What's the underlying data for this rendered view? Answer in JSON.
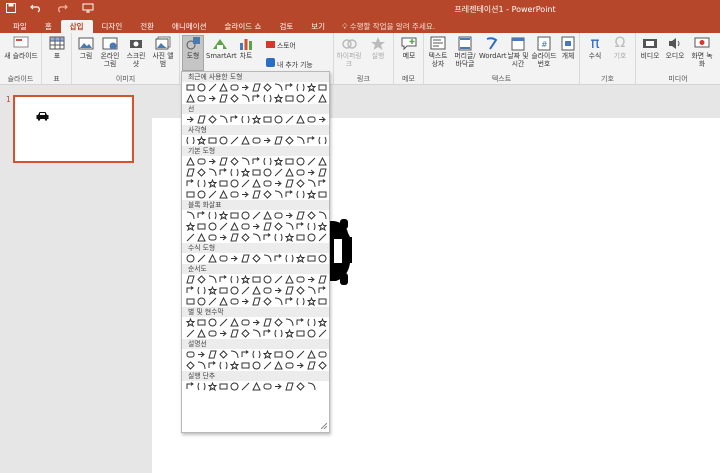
{
  "app": {
    "title": "프레젠테이션1 - PowerPoint",
    "accent": "#b7472a",
    "qat": [
      "save-icon",
      "undo-icon",
      "redo-icon",
      "present-icon"
    ]
  },
  "tabs": [
    {
      "label": "파일",
      "active": false
    },
    {
      "label": "홈",
      "active": false
    },
    {
      "label": "삽입",
      "active": true
    },
    {
      "label": "디자인",
      "active": false
    },
    {
      "label": "전환",
      "active": false
    },
    {
      "label": "애니메이션",
      "active": false
    },
    {
      "label": "슬라이드 쇼",
      "active": false
    },
    {
      "label": "검토",
      "active": false
    },
    {
      "label": "보기",
      "active": false
    }
  ],
  "tell_me": "수행할 작업을 알려 주세요.",
  "ribbon": {
    "groups": {
      "slides": "슬라이드",
      "table": "표",
      "images": "이미지",
      "links": "링크",
      "comments": "메모",
      "text": "텍스트",
      "symbols": "기호",
      "media": "미디어"
    },
    "buttons": {
      "new_slide": "새 슬라이드",
      "table": "표",
      "pictures": "그림",
      "online_pictures": "온라인 그림",
      "screenshot": "스크린샷",
      "photo_album": "사진 앨범",
      "shapes": "도형",
      "smartart": "SmartArt",
      "chart": "차트",
      "store": "스토어",
      "my_addins": "내 추가 기능",
      "hyperlink": "하이퍼링크",
      "action": "실행",
      "comment": "메모",
      "text_box": "텍스트 상자",
      "header_footer": "머리글/바닥글",
      "wordart": "WordArt",
      "date_time": "날짜 및 시간",
      "slide_number": "슬라이드 번호",
      "object": "개체",
      "equation": "수식",
      "symbol": "기호",
      "video": "비디오",
      "audio": "오디오",
      "screen_recording": "화면 녹화"
    }
  },
  "thumbnails": [
    {
      "number": "1"
    }
  ],
  "shapes_gallery": {
    "sections": [
      {
        "title": "최근에 사용한 도형",
        "rows": 2
      },
      {
        "title": "선",
        "rows": 1
      },
      {
        "title": "사각형",
        "rows": 1
      },
      {
        "title": "기본 도형",
        "rows": 4
      },
      {
        "title": "블록 화살표",
        "rows": 3
      },
      {
        "title": "수식 도형",
        "rows": 1
      },
      {
        "title": "순서도",
        "rows": 3
      },
      {
        "title": "별 및 현수막",
        "rows": 2
      },
      {
        "title": "설명선",
        "rows": 2
      },
      {
        "title": "실행 단추",
        "rows": 1
      }
    ]
  }
}
